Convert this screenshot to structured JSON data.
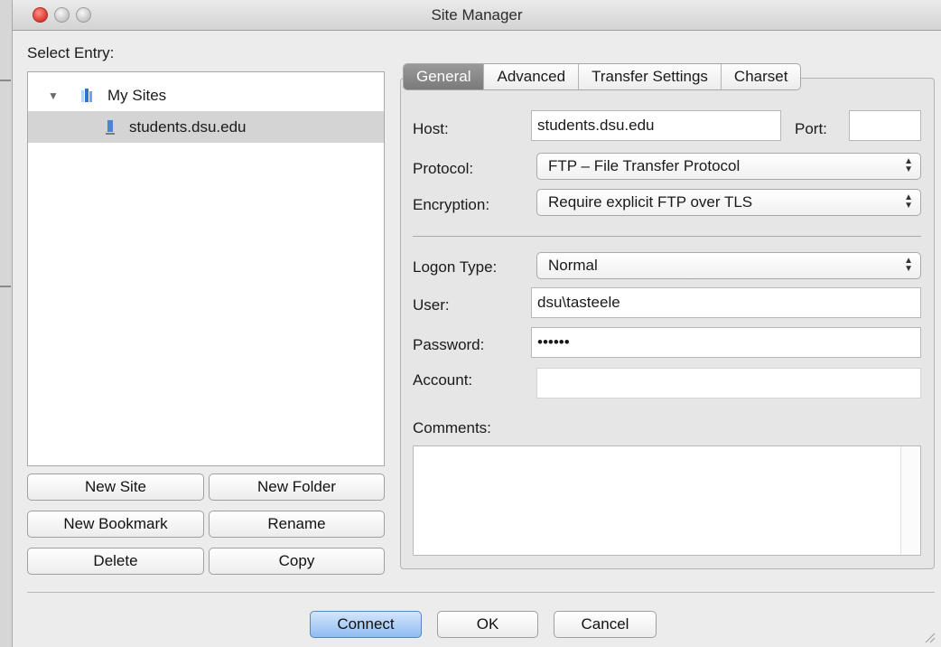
{
  "window": {
    "title": "Site Manager"
  },
  "select_entry_label": "Select Entry:",
  "tree": {
    "root_label": "My Sites",
    "items": [
      {
        "label": "students.dsu.edu",
        "selected": true
      }
    ]
  },
  "left_buttons": {
    "new_site": "New Site",
    "new_folder": "New Folder",
    "new_bookmark": "New Bookmark",
    "rename": "Rename",
    "delete": "Delete",
    "copy": "Copy"
  },
  "tabs": [
    {
      "label": "General",
      "active": true
    },
    {
      "label": "Advanced",
      "active": false
    },
    {
      "label": "Transfer Settings",
      "active": false
    },
    {
      "label": "Charset",
      "active": false
    }
  ],
  "general": {
    "host_label": "Host:",
    "host_value": "students.dsu.edu",
    "port_label": "Port:",
    "port_value": "",
    "protocol_label": "Protocol:",
    "protocol_value": "FTP – File Transfer Protocol",
    "encryption_label": "Encryption:",
    "encryption_value": "Require explicit FTP over TLS",
    "logon_type_label": "Logon Type:",
    "logon_type_value": "Normal",
    "user_label": "User:",
    "user_value": "dsu\\tasteele",
    "password_label": "Password:",
    "password_value": "••••••",
    "account_label": "Account:",
    "account_value": "",
    "comments_label": "Comments:",
    "comments_value": ""
  },
  "footer": {
    "connect": "Connect",
    "ok": "OK",
    "cancel": "Cancel"
  },
  "colors": {
    "tab_active": "#8a8a8a",
    "primary_button": "#8fbcf0",
    "selection": "#d4d4d4",
    "close_button": "#d9382e"
  }
}
